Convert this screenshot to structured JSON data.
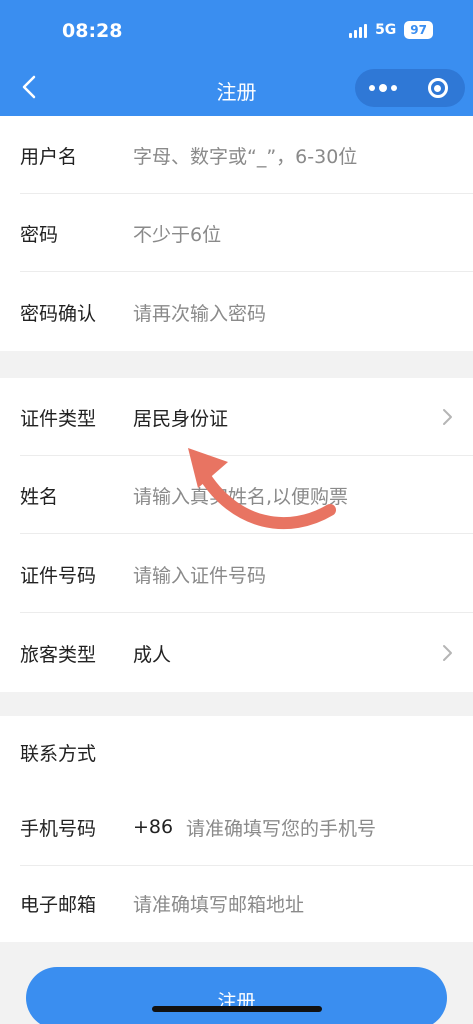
{
  "status_bar": {
    "time": "08:28",
    "network": "5G",
    "battery": "97"
  },
  "nav": {
    "title": "注册"
  },
  "account_section": {
    "username": {
      "label": "用户名",
      "placeholder": "字母、数字或“_”，6-30位"
    },
    "password": {
      "label": "密码",
      "placeholder": "不少于6位"
    },
    "password_confirm": {
      "label": "密码确认",
      "placeholder": "请再次输入密码"
    }
  },
  "identity_section": {
    "id_type": {
      "label": "证件类型",
      "value": "居民身份证"
    },
    "name": {
      "label": "姓名",
      "placeholder": "请输入真实姓名,以便购票"
    },
    "id_number": {
      "label": "证件号码",
      "placeholder": "请输入证件号码"
    },
    "passenger_type": {
      "label": "旅客类型",
      "value": "成人"
    }
  },
  "contact_section": {
    "heading": "联系方式",
    "phone": {
      "label": "手机号码",
      "prefix": "+86",
      "placeholder": "请准确填写您的手机号"
    },
    "email": {
      "label": "电子邮箱",
      "placeholder": "请准确填写邮箱地址"
    }
  },
  "submit": {
    "label": "注册"
  },
  "colors": {
    "primary": "#3a8ef0",
    "annotation_arrow": "#e87462"
  },
  "icons": [
    "back-icon",
    "more-icon",
    "close-mini-program-icon",
    "chevron-right-icon",
    "annotation-arrow-icon"
  ]
}
